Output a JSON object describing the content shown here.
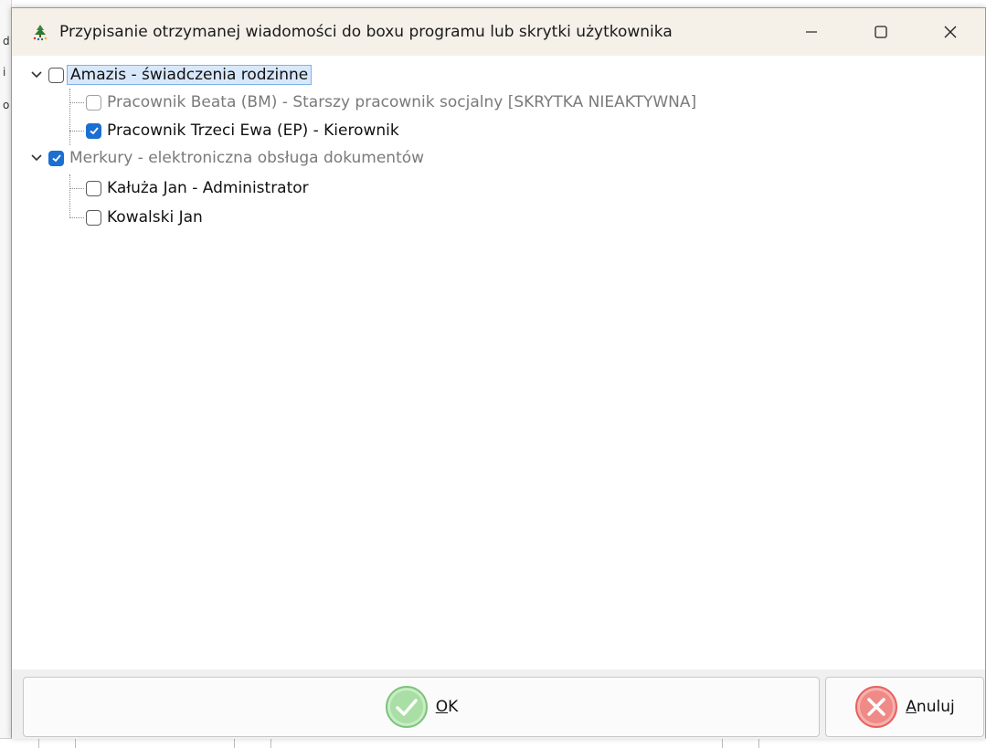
{
  "window": {
    "title": "Przypisanie otrzymanej wiadomości do boxu programu lub skrytki użytkownika"
  },
  "tree": {
    "groups": [
      {
        "label": "Amazis - świadczenia rodzinne",
        "checked": false,
        "expanded": true,
        "selected": true,
        "children": [
          {
            "label": "Pracownik Beata (BM) - Starszy pracownik socjalny [SKRYTKA NIEAKTYWNA]",
            "checked": false,
            "disabled": true
          },
          {
            "label": "Pracownik Trzeci Ewa (EP) - Kierownik",
            "checked": true,
            "disabled": false
          }
        ]
      },
      {
        "label": "Merkury - elektroniczna obsługa dokumentów",
        "checked": true,
        "expanded": true,
        "selected": false,
        "greyed": true,
        "children": [
          {
            "label": "Kałuża Jan - Administrator",
            "checked": false,
            "disabled": false
          },
          {
            "label": "Kowalski Jan",
            "checked": false,
            "disabled": false
          }
        ]
      }
    ]
  },
  "buttons": {
    "ok": {
      "label_first": "O",
      "label_rest": "K"
    },
    "cancel": {
      "label_first": "A",
      "label_rest": "nuluj"
    }
  },
  "background": {
    "left_glyphs": [
      "d",
      "i",
      "o"
    ]
  },
  "colors": {
    "accent": "#1a6fd1",
    "titlebar": "#f5f1e9",
    "ok_icon": "#7cc47a",
    "cancel_icon": "#e8605c"
  }
}
